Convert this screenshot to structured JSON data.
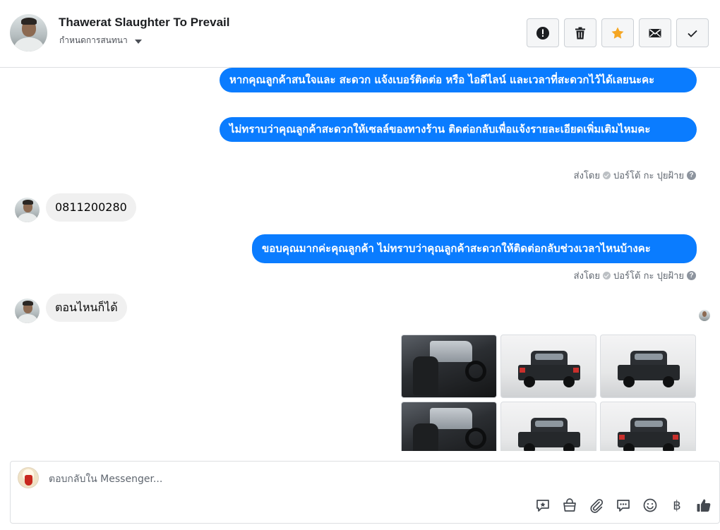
{
  "header": {
    "contact_name": "Thawerat Slaughter To Prevail",
    "assign_label": "กำหนดการสนทนา",
    "actions": {
      "spam": "alert-circle-icon",
      "delete": "trash-icon",
      "star": "star-icon",
      "mark_unread": "envelope-icon",
      "done": "check-icon"
    },
    "star_color": "#f5a623"
  },
  "thread": {
    "messages": [
      {
        "from": "page",
        "text": "หากคุณลูกค้าสนใจและ สะดวก แจ้งเบอร์ติดต่อ หรือ ไอดีไลน์ และเวลาที่สะดวกไว้ได้เลยนะคะ"
      },
      {
        "from": "page",
        "text": "ไม่ทราบว่าคุณลูกค้าสะดวกให้เซลล์ของทางร้าน ติดต่อกลับเพื่อแจ้งรายละเอียดเพิ่มเติมไหมคะ"
      },
      {
        "from": "user",
        "text": "0811200280"
      },
      {
        "from": "page",
        "text": "ขอบคุณมากค่ะคุณลูกค้า ไม่ทราบว่าคุณลูกค้าสะดวกให้ติดต่อกลับช่วงเวลาไหนบ้างคะ"
      },
      {
        "from": "user",
        "text": "ตอนไหนก็ได้"
      }
    ],
    "sent_by_label": "ส่งโดย",
    "sender_name": "ปอร์โต้ กะ ปุยฝ้าย",
    "bubble_color": "#0a7cff",
    "photos": [
      "car-interior-photo",
      "truck-rear-photo",
      "truck-front-photo",
      "car-interior-photo",
      "truck-side-photo",
      "truck-rear-photo"
    ]
  },
  "composer": {
    "placeholder": "ตอบกลับใน Messenger...",
    "tools": [
      "saved-reply-icon",
      "shop-bag-icon",
      "attachment-icon",
      "chat-bubble-icon",
      "emoji-icon",
      "baht-icon",
      "thumbs-up-icon"
    ],
    "baht_symbol": "฿"
  }
}
